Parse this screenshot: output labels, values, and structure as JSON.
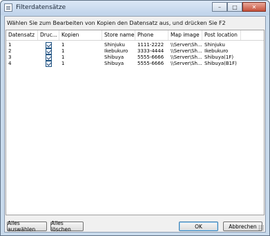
{
  "window": {
    "title": "Filterdatensätze",
    "minimize_glyph": "–",
    "maximize_glyph": "□",
    "close_glyph": "✕"
  },
  "instruction": "Wählen Sie zum Bearbeiten von Kopien den Datensatz aus, und drücken Sie F2",
  "table": {
    "columns": [
      "Datensatz",
      "Druc...",
      "Kopien",
      "Store name",
      "Phone",
      "Map image",
      "Post location"
    ],
    "rows": [
      {
        "datensatz": "1",
        "druck": true,
        "kopien": "1",
        "store": "Shinjuku",
        "phone": "1111-2222",
        "map": "\\\\Server\\Sh...",
        "post": "Shinjuku"
      },
      {
        "datensatz": "2",
        "druck": true,
        "kopien": "1",
        "store": "Ikebukuro",
        "phone": "3333-4444",
        "map": "\\\\Server\\Sh...",
        "post": "Ikebukuro"
      },
      {
        "datensatz": "3",
        "druck": true,
        "kopien": "1",
        "store": "Shibuya",
        "phone": "5555-6666",
        "map": "\\\\Server\\Sh...",
        "post": "Shibuya(1F)"
      },
      {
        "datensatz": "4",
        "druck": true,
        "kopien": "1",
        "store": "Shibuya",
        "phone": "5555-6666",
        "map": "\\\\Server\\Sh...",
        "post": "Shibuya(B1F)"
      }
    ]
  },
  "buttons": {
    "select_all": "Alles auswählen",
    "delete_all": "Alles löschen",
    "ok": "OK",
    "cancel": "Abbrechen"
  }
}
